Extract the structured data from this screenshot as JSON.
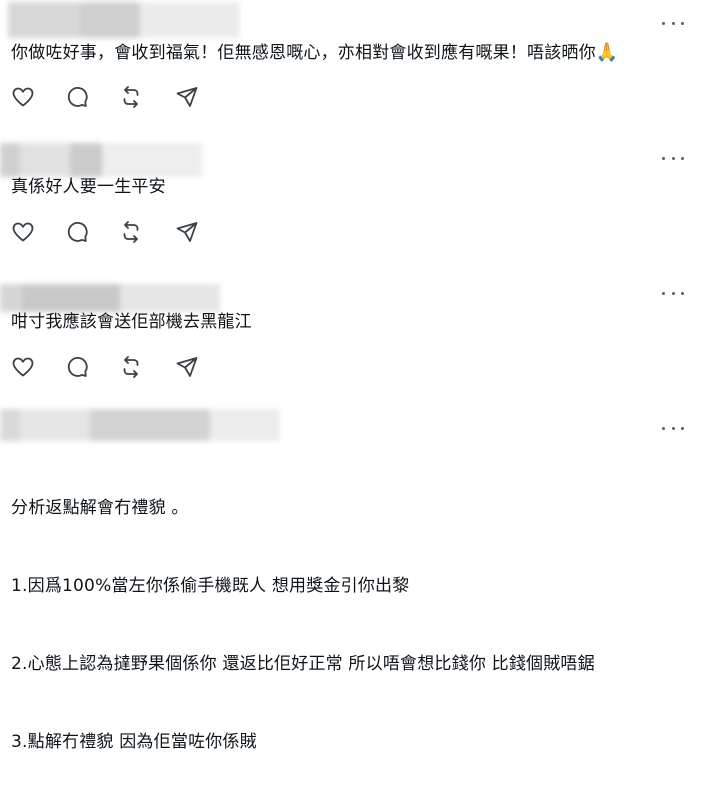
{
  "colors": {
    "text": "#0f1419",
    "icon": "#3a4148",
    "divider": "#e4e7ea",
    "more_dots": "#536471"
  },
  "posts": [
    {
      "text": "你做咗好事，會收到福氣！佢無感恩嘅心，亦相對會收到應有嘅果！唔該晒你",
      "emoji": "🙏"
    },
    {
      "text": "真係好人要一生平安"
    },
    {
      "text": "咁寸我應該會送佢部機去黑龍江"
    },
    {
      "text_lines": [
        "分析返點解會冇禮貌 。",
        "1.因爲100%當左你係偷手機既人 想用獎金引你出黎",
        "2.心態上認為撻野果個係你 還返比佢好正常 所以唔會想比錢你 比錢個賊唔鋸",
        "3.點解冇禮貌 因為佢當咗你係賊"
      ]
    }
  ],
  "icons": {
    "more": "more-dots-icon",
    "like": "heart-icon",
    "reply": "comment-bubble-icon",
    "repost": "repost-icon",
    "share": "send-arrow-icon"
  }
}
